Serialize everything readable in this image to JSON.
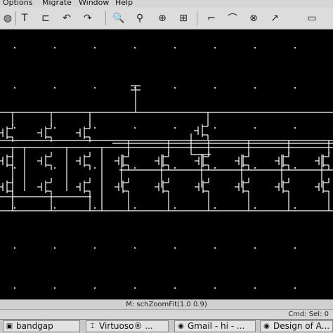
{
  "menu": {
    "items": [
      {
        "label": "Options",
        "key": "O",
        "rest": "ptions"
      },
      {
        "label": "Migrate",
        "key": "M",
        "rest": "igrate"
      },
      {
        "label": "Window",
        "key": "W",
        "rest": "indow"
      },
      {
        "label": "Help",
        "key": "H",
        "rest": "elp"
      }
    ]
  },
  "toolbar": {
    "tools": [
      {
        "icon": "save-icon",
        "glyph": "◍"
      },
      {
        "icon": "text-tool-icon",
        "glyph": "T"
      },
      {
        "icon": "pin-icon",
        "glyph": "⊏"
      },
      {
        "icon": "undo-icon",
        "glyph": "↶"
      },
      {
        "icon": "redo-icon",
        "glyph": "↷"
      },
      {
        "icon": "zoom-in-icon",
        "glyph": "🔍"
      },
      {
        "icon": "zoom-out-icon",
        "glyph": "⚲"
      },
      {
        "icon": "zoom-fit-icon",
        "glyph": "⊕"
      },
      {
        "icon": "zoom-area-icon",
        "glyph": "⊞"
      },
      {
        "icon": "wire-icon",
        "glyph": "⌐"
      },
      {
        "icon": "select-icon",
        "glyph": "⌒"
      },
      {
        "icon": "search-icon",
        "glyph": "⊗"
      },
      {
        "icon": "arrow-icon",
        "glyph": "↗"
      },
      {
        "icon": "panel-icon",
        "glyph": "▭"
      }
    ]
  },
  "status": {
    "mouse": "M: schZoomFit(1.0 0.9)",
    "cmd": "Cmd: Sel: 0"
  },
  "taskbar": {
    "tasks": [
      {
        "label": "bandgap",
        "icon": "terminal-icon"
      },
      {
        "label": "Virtuoso® ...",
        "icon": "virtuoso-icon"
      },
      {
        "label": "Gmail - hi - ...",
        "icon": "browser-icon"
      },
      {
        "label": "Design of A...",
        "icon": "browser-icon"
      }
    ]
  },
  "colors": {
    "canvas": "#000000",
    "wire": "#ffffff",
    "grid_dot": "#cfcfcf"
  }
}
